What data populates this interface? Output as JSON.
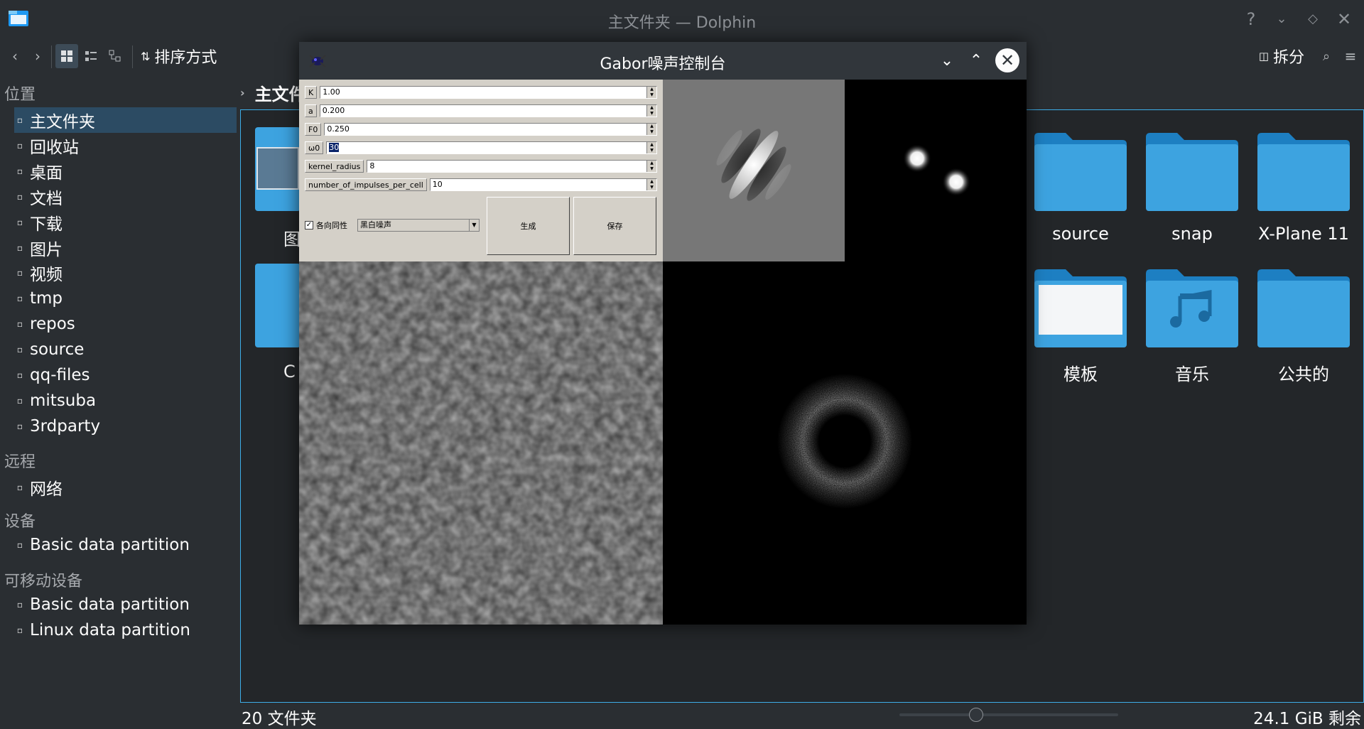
{
  "window": {
    "title": "主文件夹 — Dolphin"
  },
  "toolbar": {
    "sort_label": "排序方式",
    "split_label": "拆分"
  },
  "breadcrumb": {
    "current": "主文件夹"
  },
  "sidebar": {
    "places_header": "位置",
    "places": [
      {
        "label": "主文件夹",
        "icon": "home-icon"
      },
      {
        "label": "回收站",
        "icon": "trash-icon"
      },
      {
        "label": "桌面",
        "icon": "desktop-icon"
      },
      {
        "label": "文档",
        "icon": "documents-icon"
      },
      {
        "label": "下载",
        "icon": "download-icon"
      },
      {
        "label": "图片",
        "icon": "pictures-icon"
      },
      {
        "label": "视频",
        "icon": "videos-icon"
      },
      {
        "label": "tmp",
        "icon": "clock-icon"
      },
      {
        "label": "repos",
        "icon": "folder-icon"
      },
      {
        "label": "source",
        "icon": "folder-icon"
      },
      {
        "label": "qq-files",
        "icon": "folder-icon"
      },
      {
        "label": "mitsuba",
        "icon": "folder-icon"
      },
      {
        "label": "3rdparty",
        "icon": "folder-icon"
      }
    ],
    "remote_header": "远程",
    "remote": [
      {
        "label": "网络",
        "icon": "network-icon"
      }
    ],
    "devices_header": "设备",
    "devices": [
      {
        "label": "Basic data partition",
        "icon": "drive-icon"
      }
    ],
    "removable_header": "可移动设备",
    "removable": [
      {
        "label": "Basic data partition",
        "icon": "removable-drive-icon"
      },
      {
        "label": "Linux data partition",
        "icon": "drive-icon"
      }
    ]
  },
  "folders_row1": [
    "source",
    "snap",
    "X-Plane 11"
  ],
  "folders_row2": [
    "模板",
    "音乐",
    "公共的"
  ],
  "partial_labels": {
    "left1": "图",
    "left2": "C"
  },
  "status": {
    "count": "20 文件夹",
    "free": "24.1 GiB 剩余"
  },
  "gabor": {
    "title": "Gabor噪声控制台",
    "params": [
      {
        "name": "K",
        "value": "1.00"
      },
      {
        "name": "a",
        "value": "0.200"
      },
      {
        "name": "F0",
        "value": "0.250"
      },
      {
        "name": "ω0",
        "value": "30"
      },
      {
        "name": "kernel_radius",
        "value": "8"
      },
      {
        "name": "number_of_impulses_per_cell",
        "value": "10"
      }
    ],
    "isotropic_label": "各向同性",
    "isotropic_checked": true,
    "noise_type": "黑白噪声",
    "generate_label": "生成",
    "save_label": "保存"
  },
  "colors": {
    "accent": "#3daee9",
    "folder": "#3da3e0",
    "selection": "#2c4b63"
  }
}
